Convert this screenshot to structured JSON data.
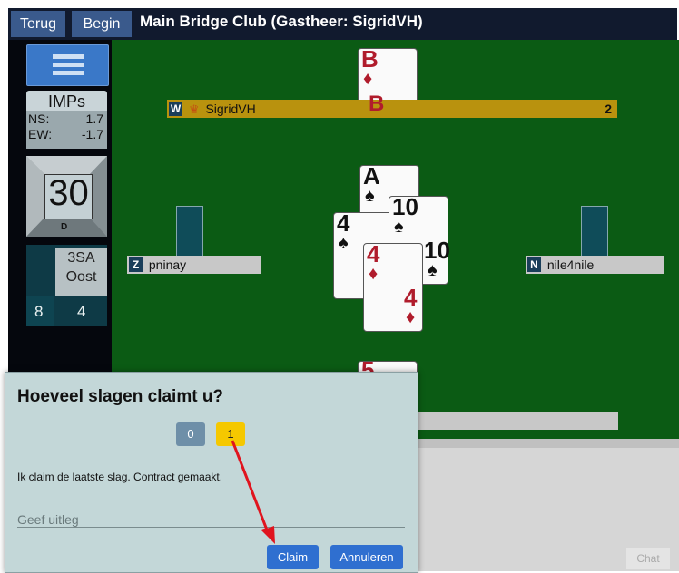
{
  "topbar": {
    "back_label": "Terug",
    "start_label": "Begin",
    "title": "Main Bridge Club (Gastheer: SigridVH)"
  },
  "score": {
    "type": "IMPs",
    "ns_label": "NS:",
    "ns_value": "1.7",
    "ew_label": "EW:",
    "ew_value": "-1.7"
  },
  "board": {
    "number": "30",
    "dealer": "D"
  },
  "contract": {
    "bid": "3SA",
    "declarer": "Oost",
    "ns_tricks": "8",
    "ew_tricks": "4"
  },
  "players": {
    "west": {
      "seat": "W",
      "name": "SigridVH",
      "count": "2"
    },
    "south": {
      "seat": "Z",
      "name": "pninay"
    },
    "north": {
      "seat": "N",
      "name": "nile4nile"
    }
  },
  "cards": {
    "top": {
      "rank": "B",
      "suit": "♦",
      "rank2": "B"
    },
    "ace": {
      "rank": "A",
      "suit": "♠"
    },
    "ten": {
      "rank": "10",
      "suit": "♠",
      "rank2": "10",
      "suit2": "♠"
    },
    "four_sp": {
      "rank": "4",
      "suit": "♠"
    },
    "four_di": {
      "rank": "4",
      "suit": "♦",
      "rank2": "4",
      "suit2": "♦"
    },
    "bottom": {
      "rank": "5"
    }
  },
  "dialog": {
    "title": "Hoeveel slagen claimt u?",
    "options": [
      "0",
      "1"
    ],
    "message": "Ik claim de laatste slag. Contract gemaakt.",
    "explain_placeholder": "Geef uitleg",
    "claim_label": "Claim",
    "cancel_label": "Annuleren"
  },
  "chat_label": "Chat",
  "colors": {
    "accent_blue": "#2f6fd0",
    "selected_option": "#f5c800",
    "annotation_arrow": "#e0141e",
    "table_green": "#0b5b14"
  }
}
